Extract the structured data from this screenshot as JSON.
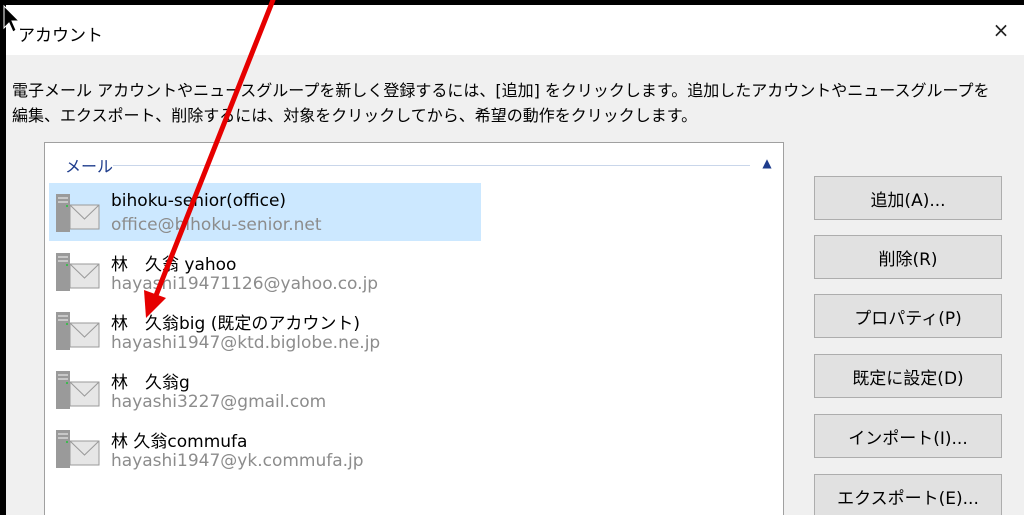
{
  "window": {
    "title": "アカウント",
    "close_label": "×"
  },
  "description": {
    "line1": "電子メール アカウントやニュースグループを新しく登録するには、[追加] をクリックします。追加したアカウントやニュースグループを",
    "line2": "編集、エクスポート、削除するには、対象をクリックしてから、希望の動作をクリックします。"
  },
  "account_list": {
    "group_label": "メール",
    "collapse_icon": "chevron-up-icon",
    "accounts": [
      {
        "name": "bihoku-senior(office)",
        "email": "office@bihoku-senior.net",
        "selected": true
      },
      {
        "name": "林　久翁 yahoo",
        "email": "hayashi19471126@yahoo.co.jp",
        "selected": false
      },
      {
        "name": "林　久翁big (既定のアカウント)",
        "email": "hayashi1947@ktd.biglobe.ne.jp",
        "selected": false
      },
      {
        "name": "林　久翁g",
        "email": "hayashi3227@gmail.com",
        "selected": false
      },
      {
        "name": "林 久翁commufa",
        "email": "hayashi1947@yk.commufa.jp",
        "selected": false
      }
    ]
  },
  "buttons": {
    "add": "追加(A)...",
    "remove": "削除(R)",
    "properties": "プロパティ(P)",
    "set_default": "既定に設定(D)",
    "import": "インポート(I)...",
    "export": "エクスポート(E)..."
  },
  "colors": {
    "selection": "#cce8ff",
    "annotation_arrow": "#e60000",
    "group_header": "#1e3c8c"
  }
}
